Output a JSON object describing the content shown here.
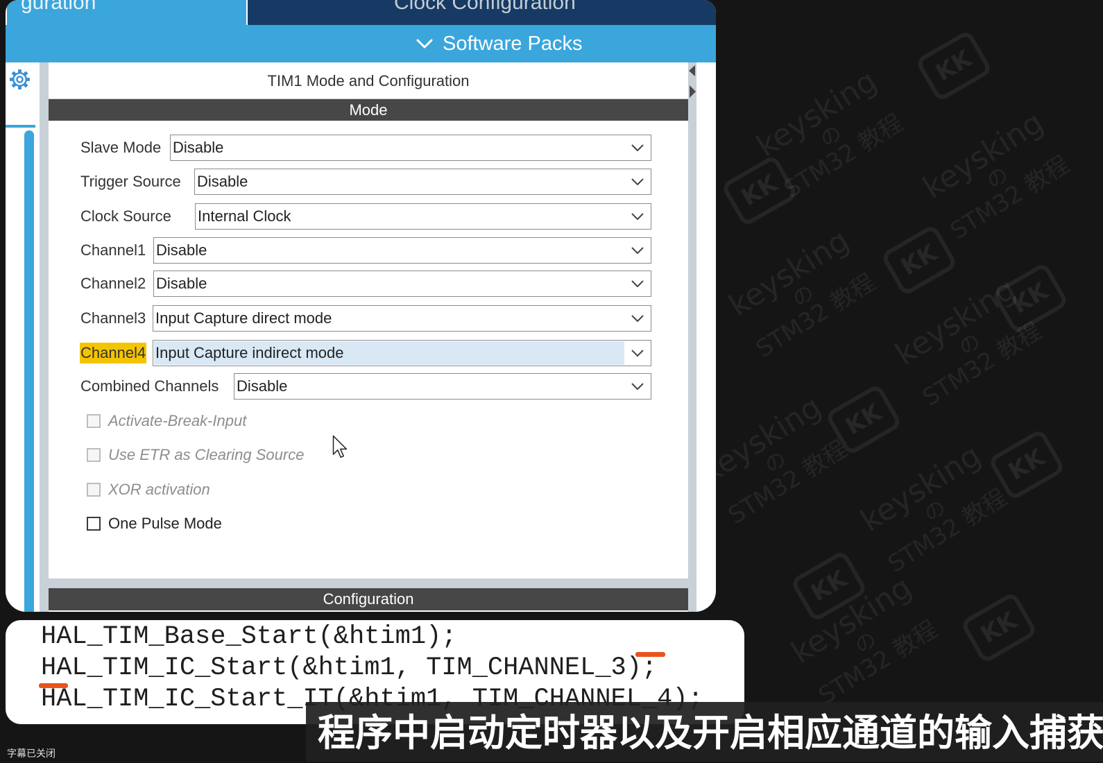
{
  "tabs": [
    {
      "label": "guration",
      "selected": true
    },
    {
      "label": "Clock Configuration",
      "selected": false
    }
  ],
  "header": {
    "software_packs_label": "Software Packs"
  },
  "panel": {
    "title": "TIM1 Mode and Configuration",
    "mode_section_label": "Mode",
    "configuration_section_label": "Configuration"
  },
  "mode_fields": [
    {
      "label": "Slave Mode",
      "value": "Disable"
    },
    {
      "label": "Trigger Source",
      "value": "Disable"
    },
    {
      "label": "Clock Source",
      "value": "Internal Clock"
    },
    {
      "label": "Channel1",
      "value": "Disable"
    },
    {
      "label": "Channel2",
      "value": "Disable"
    },
    {
      "label": "Channel3",
      "value": "Input Capture direct mode"
    },
    {
      "label": "Channel4",
      "value": "Input Capture indirect mode",
      "highlighted": true
    },
    {
      "label": "Combined Channels",
      "value": "Disable"
    }
  ],
  "checkboxes": [
    {
      "label": "Activate-Break-Input",
      "checked": false,
      "enabled": false
    },
    {
      "label": "Use ETR as Clearing Source",
      "checked": false,
      "enabled": false
    },
    {
      "label": "XOR activation",
      "checked": false,
      "enabled": false
    },
    {
      "label": "One Pulse Mode",
      "checked": false,
      "enabled": true
    }
  ],
  "code": {
    "lines": [
      "HAL_TIM_Base_Start(&htim1);",
      "HAL_TIM_IC_Start(&htim1, TIM_CHANNEL_3);",
      "HAL_TIM_IC_Start_IT(&htim1, TIM_CHANNEL_4);"
    ]
  },
  "subtitle": "程序中启动定时器以及开启相应通道的输入捕获",
  "caption_status": "字幕已关闭",
  "watermark": {
    "brand": "keysking",
    "connector": "の",
    "course": "STM32 教程",
    "logo": "KK"
  },
  "icons": {
    "sidebar": "gear-icon",
    "header": "chevron-down-icon",
    "select": "chevron-down-icon",
    "pointer": "mouse-cursor-icon"
  },
  "colors": {
    "header_blue": "#3aa6dc",
    "tab_active": "#3aa6dc",
    "tab_inactive": "#163a63",
    "section_bar": "#474747",
    "highlight": "#f5c400",
    "selection": "#d8e8f5",
    "marker": "#e8541c"
  }
}
